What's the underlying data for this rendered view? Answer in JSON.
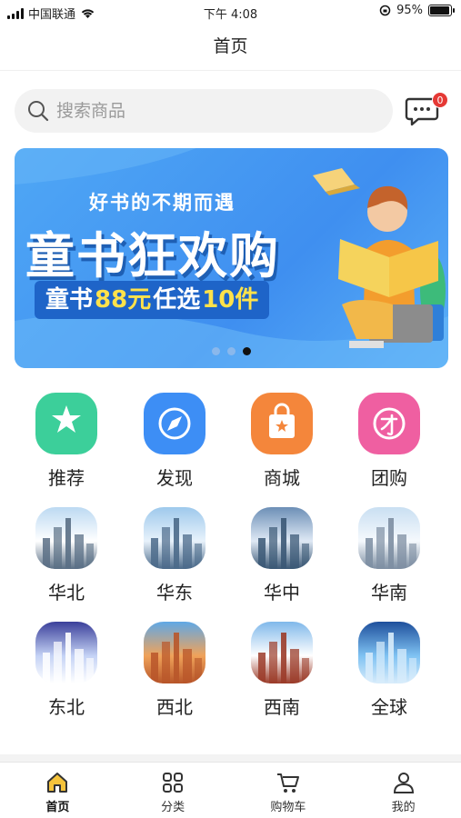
{
  "status_bar": {
    "carrier": "中国联通",
    "time": "下午 4:08",
    "battery": "95%",
    "battery_level": 0.95
  },
  "nav": {
    "title": "首页"
  },
  "search": {
    "placeholder": "搜索商品",
    "icon": "search-icon"
  },
  "messages": {
    "badge": "0",
    "icon": "chat-bubble-icon"
  },
  "banner": {
    "subtitle": "好书的不期而遇",
    "title": "童书狂欢购",
    "offer_prefix": "童书",
    "offer_price": "88元",
    "offer_middle": "任选",
    "offer_count": "10件",
    "active_slide": 3,
    "slide_count": 3
  },
  "categories": [
    {
      "label": "推荐",
      "icon": "star-bag-icon",
      "color": "#3ccf9a"
    },
    {
      "label": "发现",
      "icon": "compass-icon",
      "color": "#3d8ef5"
    },
    {
      "label": "商城",
      "icon": "shopping-bag-icon",
      "color": "#f4863b"
    },
    {
      "label": "团购",
      "icon": "group-buy-icon",
      "color": "#ef5fa1"
    },
    {
      "label": "华北",
      "icon": "city-image-north-china"
    },
    {
      "label": "华东",
      "icon": "city-image-east-china"
    },
    {
      "label": "华中",
      "icon": "city-image-central-china"
    },
    {
      "label": "华南",
      "icon": "city-image-south-china"
    },
    {
      "label": "东北",
      "icon": "city-image-northeast"
    },
    {
      "label": "西北",
      "icon": "city-image-northwest"
    },
    {
      "label": "西南",
      "icon": "city-image-southwest"
    },
    {
      "label": "全球",
      "icon": "globe-image-global"
    }
  ],
  "tab_bar": [
    {
      "label": "首页",
      "icon": "home-icon",
      "active": true
    },
    {
      "label": "分类",
      "icon": "grid-icon"
    },
    {
      "label": "购物车",
      "icon": "cart-icon"
    },
    {
      "label": "我的",
      "icon": "user-icon"
    }
  ]
}
